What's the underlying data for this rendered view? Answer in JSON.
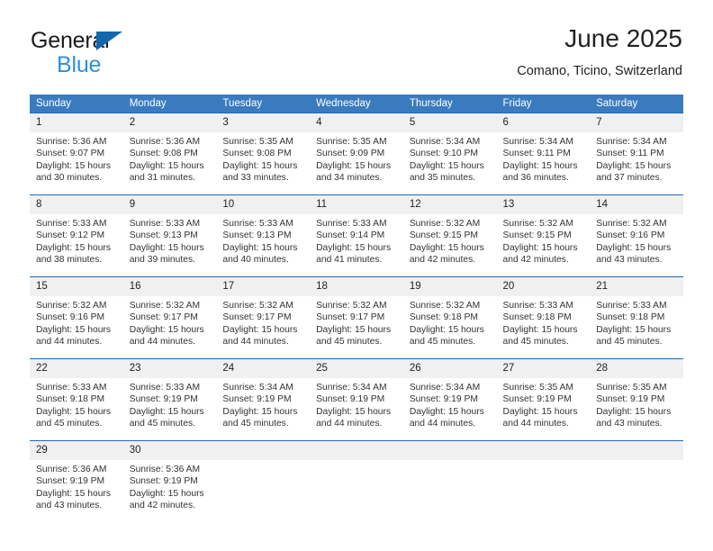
{
  "brand": {
    "name_top": "General",
    "name_bottom": "Blue",
    "triangle_color": "#1266ad",
    "blue_text_color": "#2e8fd6"
  },
  "header": {
    "title": "June 2025",
    "subtitle": "Comano, Ticino, Switzerland"
  },
  "colors": {
    "header_row_bg": "#3a7bbf",
    "row_divider": "#1f6cb0",
    "daynum_bg": "#f0f0f0",
    "page_bg": "#ffffff"
  },
  "weekday_headers": [
    "Sunday",
    "Monday",
    "Tuesday",
    "Wednesday",
    "Thursday",
    "Friday",
    "Saturday"
  ],
  "weeks": [
    [
      {
        "day": "1",
        "sunrise": "Sunrise: 5:36 AM",
        "sunset": "Sunset: 9:07 PM",
        "daylight1": "Daylight: 15 hours",
        "daylight2": "and 30 minutes."
      },
      {
        "day": "2",
        "sunrise": "Sunrise: 5:36 AM",
        "sunset": "Sunset: 9:08 PM",
        "daylight1": "Daylight: 15 hours",
        "daylight2": "and 31 minutes."
      },
      {
        "day": "3",
        "sunrise": "Sunrise: 5:35 AM",
        "sunset": "Sunset: 9:08 PM",
        "daylight1": "Daylight: 15 hours",
        "daylight2": "and 33 minutes."
      },
      {
        "day": "4",
        "sunrise": "Sunrise: 5:35 AM",
        "sunset": "Sunset: 9:09 PM",
        "daylight1": "Daylight: 15 hours",
        "daylight2": "and 34 minutes."
      },
      {
        "day": "5",
        "sunrise": "Sunrise: 5:34 AM",
        "sunset": "Sunset: 9:10 PM",
        "daylight1": "Daylight: 15 hours",
        "daylight2": "and 35 minutes."
      },
      {
        "day": "6",
        "sunrise": "Sunrise: 5:34 AM",
        "sunset": "Sunset: 9:11 PM",
        "daylight1": "Daylight: 15 hours",
        "daylight2": "and 36 minutes."
      },
      {
        "day": "7",
        "sunrise": "Sunrise: 5:34 AM",
        "sunset": "Sunset: 9:11 PM",
        "daylight1": "Daylight: 15 hours",
        "daylight2": "and 37 minutes."
      }
    ],
    [
      {
        "day": "8",
        "sunrise": "Sunrise: 5:33 AM",
        "sunset": "Sunset: 9:12 PM",
        "daylight1": "Daylight: 15 hours",
        "daylight2": "and 38 minutes."
      },
      {
        "day": "9",
        "sunrise": "Sunrise: 5:33 AM",
        "sunset": "Sunset: 9:13 PM",
        "daylight1": "Daylight: 15 hours",
        "daylight2": "and 39 minutes."
      },
      {
        "day": "10",
        "sunrise": "Sunrise: 5:33 AM",
        "sunset": "Sunset: 9:13 PM",
        "daylight1": "Daylight: 15 hours",
        "daylight2": "and 40 minutes."
      },
      {
        "day": "11",
        "sunrise": "Sunrise: 5:33 AM",
        "sunset": "Sunset: 9:14 PM",
        "daylight1": "Daylight: 15 hours",
        "daylight2": "and 41 minutes."
      },
      {
        "day": "12",
        "sunrise": "Sunrise: 5:32 AM",
        "sunset": "Sunset: 9:15 PM",
        "daylight1": "Daylight: 15 hours",
        "daylight2": "and 42 minutes."
      },
      {
        "day": "13",
        "sunrise": "Sunrise: 5:32 AM",
        "sunset": "Sunset: 9:15 PM",
        "daylight1": "Daylight: 15 hours",
        "daylight2": "and 42 minutes."
      },
      {
        "day": "14",
        "sunrise": "Sunrise: 5:32 AM",
        "sunset": "Sunset: 9:16 PM",
        "daylight1": "Daylight: 15 hours",
        "daylight2": "and 43 minutes."
      }
    ],
    [
      {
        "day": "15",
        "sunrise": "Sunrise: 5:32 AM",
        "sunset": "Sunset: 9:16 PM",
        "daylight1": "Daylight: 15 hours",
        "daylight2": "and 44 minutes."
      },
      {
        "day": "16",
        "sunrise": "Sunrise: 5:32 AM",
        "sunset": "Sunset: 9:17 PM",
        "daylight1": "Daylight: 15 hours",
        "daylight2": "and 44 minutes."
      },
      {
        "day": "17",
        "sunrise": "Sunrise: 5:32 AM",
        "sunset": "Sunset: 9:17 PM",
        "daylight1": "Daylight: 15 hours",
        "daylight2": "and 44 minutes."
      },
      {
        "day": "18",
        "sunrise": "Sunrise: 5:32 AM",
        "sunset": "Sunset: 9:17 PM",
        "daylight1": "Daylight: 15 hours",
        "daylight2": "and 45 minutes."
      },
      {
        "day": "19",
        "sunrise": "Sunrise: 5:32 AM",
        "sunset": "Sunset: 9:18 PM",
        "daylight1": "Daylight: 15 hours",
        "daylight2": "and 45 minutes."
      },
      {
        "day": "20",
        "sunrise": "Sunrise: 5:33 AM",
        "sunset": "Sunset: 9:18 PM",
        "daylight1": "Daylight: 15 hours",
        "daylight2": "and 45 minutes."
      },
      {
        "day": "21",
        "sunrise": "Sunrise: 5:33 AM",
        "sunset": "Sunset: 9:18 PM",
        "daylight1": "Daylight: 15 hours",
        "daylight2": "and 45 minutes."
      }
    ],
    [
      {
        "day": "22",
        "sunrise": "Sunrise: 5:33 AM",
        "sunset": "Sunset: 9:18 PM",
        "daylight1": "Daylight: 15 hours",
        "daylight2": "and 45 minutes."
      },
      {
        "day": "23",
        "sunrise": "Sunrise: 5:33 AM",
        "sunset": "Sunset: 9:19 PM",
        "daylight1": "Daylight: 15 hours",
        "daylight2": "and 45 minutes."
      },
      {
        "day": "24",
        "sunrise": "Sunrise: 5:34 AM",
        "sunset": "Sunset: 9:19 PM",
        "daylight1": "Daylight: 15 hours",
        "daylight2": "and 45 minutes."
      },
      {
        "day": "25",
        "sunrise": "Sunrise: 5:34 AM",
        "sunset": "Sunset: 9:19 PM",
        "daylight1": "Daylight: 15 hours",
        "daylight2": "and 44 minutes."
      },
      {
        "day": "26",
        "sunrise": "Sunrise: 5:34 AM",
        "sunset": "Sunset: 9:19 PM",
        "daylight1": "Daylight: 15 hours",
        "daylight2": "and 44 minutes."
      },
      {
        "day": "27",
        "sunrise": "Sunrise: 5:35 AM",
        "sunset": "Sunset: 9:19 PM",
        "daylight1": "Daylight: 15 hours",
        "daylight2": "and 44 minutes."
      },
      {
        "day": "28",
        "sunrise": "Sunrise: 5:35 AM",
        "sunset": "Sunset: 9:19 PM",
        "daylight1": "Daylight: 15 hours",
        "daylight2": "and 43 minutes."
      }
    ],
    [
      {
        "day": "29",
        "sunrise": "Sunrise: 5:36 AM",
        "sunset": "Sunset: 9:19 PM",
        "daylight1": "Daylight: 15 hours",
        "daylight2": "and 43 minutes."
      },
      {
        "day": "30",
        "sunrise": "Sunrise: 5:36 AM",
        "sunset": "Sunset: 9:19 PM",
        "daylight1": "Daylight: 15 hours",
        "daylight2": "and 42 minutes."
      },
      {
        "day": "",
        "sunrise": "",
        "sunset": "",
        "daylight1": "",
        "daylight2": ""
      },
      {
        "day": "",
        "sunrise": "",
        "sunset": "",
        "daylight1": "",
        "daylight2": ""
      },
      {
        "day": "",
        "sunrise": "",
        "sunset": "",
        "daylight1": "",
        "daylight2": ""
      },
      {
        "day": "",
        "sunrise": "",
        "sunset": "",
        "daylight1": "",
        "daylight2": ""
      },
      {
        "day": "",
        "sunrise": "",
        "sunset": "",
        "daylight1": "",
        "daylight2": ""
      }
    ]
  ]
}
